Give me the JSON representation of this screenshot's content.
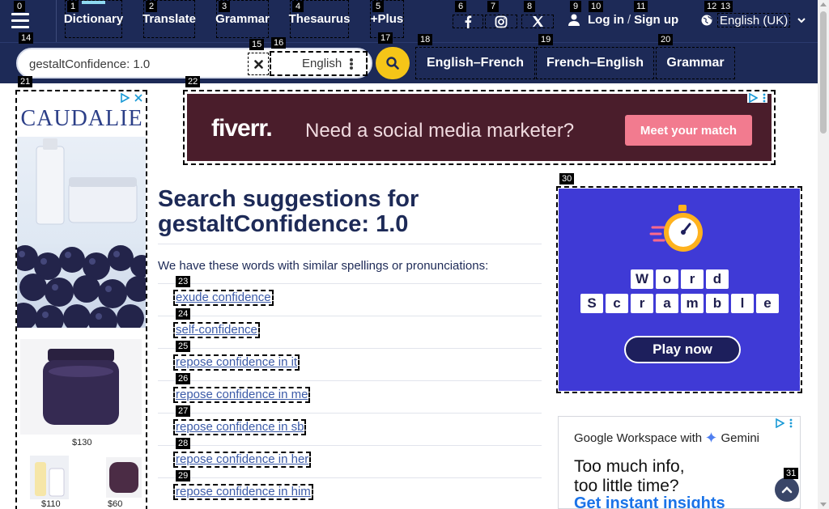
{
  "header": {
    "tabs": [
      {
        "label": "Dictionary",
        "badge": "1"
      },
      {
        "label": "Translate",
        "badge": "2"
      },
      {
        "label": "Grammar",
        "badge": "3"
      },
      {
        "label": "Thesaurus",
        "badge": "4"
      },
      {
        "label": "+Plus",
        "badge": "5"
      }
    ],
    "menu_badge": "0",
    "social": [
      {
        "icon": "facebook-icon",
        "badge": "6"
      },
      {
        "icon": "instagram-icon",
        "badge": "7"
      },
      {
        "icon": "x-icon",
        "badge": "8"
      }
    ],
    "auth": {
      "login_label": "Log in",
      "separator": "/",
      "signup_label": "Sign up",
      "user_badge": "9",
      "login_badge": "10",
      "signup_badge": "11"
    },
    "language": {
      "label": "English (UK)",
      "badge_globe": "12",
      "badge_label": "13"
    }
  },
  "search": {
    "value": "gestaltConfidence: 1.0",
    "input_badge": "14",
    "clear_badge": "15",
    "dictionary_select": "English",
    "select_badge": "16",
    "search_badge": "17"
  },
  "quick_links": [
    {
      "label": "English–French",
      "badge": "18"
    },
    {
      "label": "French–English",
      "badge": "19"
    },
    {
      "label": "Grammar",
      "badge": "20"
    }
  ],
  "left_ad": {
    "badge": "21",
    "brand": "CAUDALIE",
    "prices": [
      "$130",
      "$110",
      "$60"
    ]
  },
  "banner_ad": {
    "badge": "22",
    "brand": "fiverr.",
    "headline": "Need a social media marketer?",
    "cta": "Meet your match"
  },
  "main": {
    "title_line1": "Search suggestions for",
    "title_line2": "gestaltConfidence: 1.0",
    "intro": "We have these words with similar spellings or pronunciations:",
    "suggestions": [
      {
        "text": "exude confidence",
        "badge": "23"
      },
      {
        "text": "self-confidence",
        "badge": "24"
      },
      {
        "text": "repose confidence in it",
        "badge": "25"
      },
      {
        "text": "repose confidence in me",
        "badge": "26"
      },
      {
        "text": "repose confidence in sb",
        "badge": "27"
      },
      {
        "text": "repose confidence in her",
        "badge": "28"
      },
      {
        "text": "repose confidence in him",
        "badge": "29"
      }
    ]
  },
  "right_ad": {
    "badge": "30",
    "row1": [
      "W",
      "o",
      "r",
      "d"
    ],
    "row2": [
      "S",
      "c",
      "r",
      "a",
      "m",
      "b",
      "l",
      "e"
    ],
    "cta": "Play now"
  },
  "google_ad": {
    "line1": "Google Workspace with",
    "gemini": "Gemini",
    "headline1": "Too much info,",
    "headline2": "too little time?",
    "cta": "Get instant insights"
  },
  "scroll_top_badge": "31",
  "colors": {
    "brand_navy": "#1d2a57",
    "accent_yellow": "#f5c518",
    "link_blue": "#3c5ba8"
  }
}
